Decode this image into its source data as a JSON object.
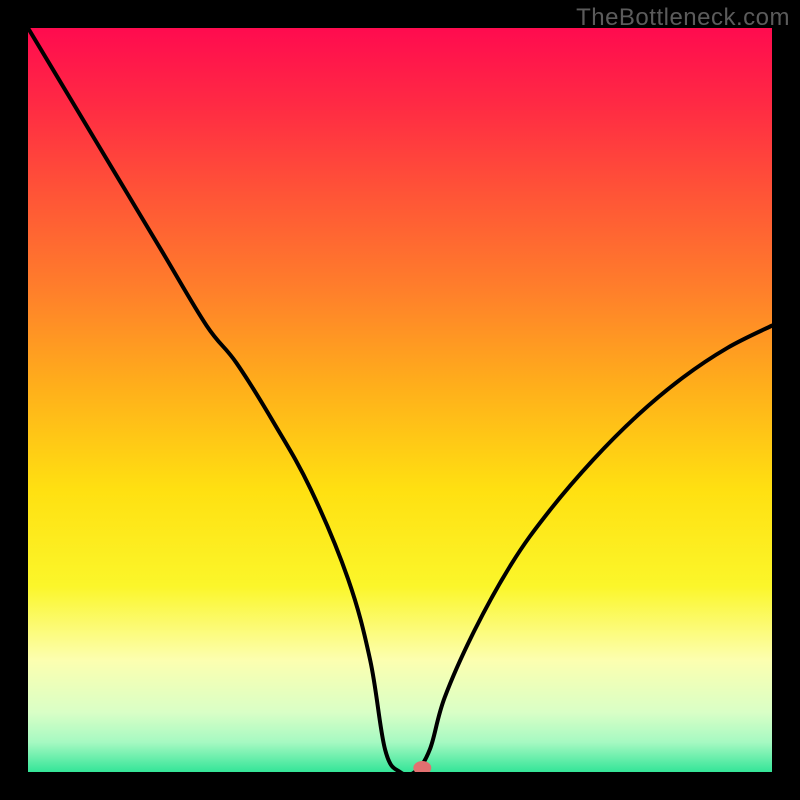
{
  "watermark": "TheBottleneck.com",
  "chart_data": {
    "type": "line",
    "title": "",
    "xlabel": "",
    "ylabel": "",
    "xlim": [
      0,
      100
    ],
    "ylim": [
      0,
      100
    ],
    "x": [
      0,
      6,
      12,
      18,
      24,
      28,
      33,
      38,
      43,
      46,
      48,
      50,
      52,
      54,
      56,
      60,
      65,
      70,
      76,
      82,
      88,
      94,
      100
    ],
    "values": [
      100,
      90,
      80,
      70,
      60,
      55,
      47,
      38,
      26,
      15,
      3,
      0,
      0,
      3,
      10,
      19,
      28,
      35,
      42,
      48,
      53,
      57,
      60
    ],
    "marker": {
      "x": 53,
      "y": 0
    },
    "background_gradient": {
      "stops": [
        {
          "pos": 0.0,
          "color": "#ff0b4f"
        },
        {
          "pos": 0.1,
          "color": "#ff2944"
        },
        {
          "pos": 0.22,
          "color": "#ff5337"
        },
        {
          "pos": 0.35,
          "color": "#ff7e2b"
        },
        {
          "pos": 0.48,
          "color": "#ffae1b"
        },
        {
          "pos": 0.62,
          "color": "#ffe011"
        },
        {
          "pos": 0.75,
          "color": "#fbf62a"
        },
        {
          "pos": 0.85,
          "color": "#fcffb0"
        },
        {
          "pos": 0.92,
          "color": "#d9ffc6"
        },
        {
          "pos": 0.96,
          "color": "#a6f9c2"
        },
        {
          "pos": 1.0,
          "color": "#34e598"
        }
      ]
    },
    "line_color": "#000000",
    "marker_color": "#e27070"
  }
}
